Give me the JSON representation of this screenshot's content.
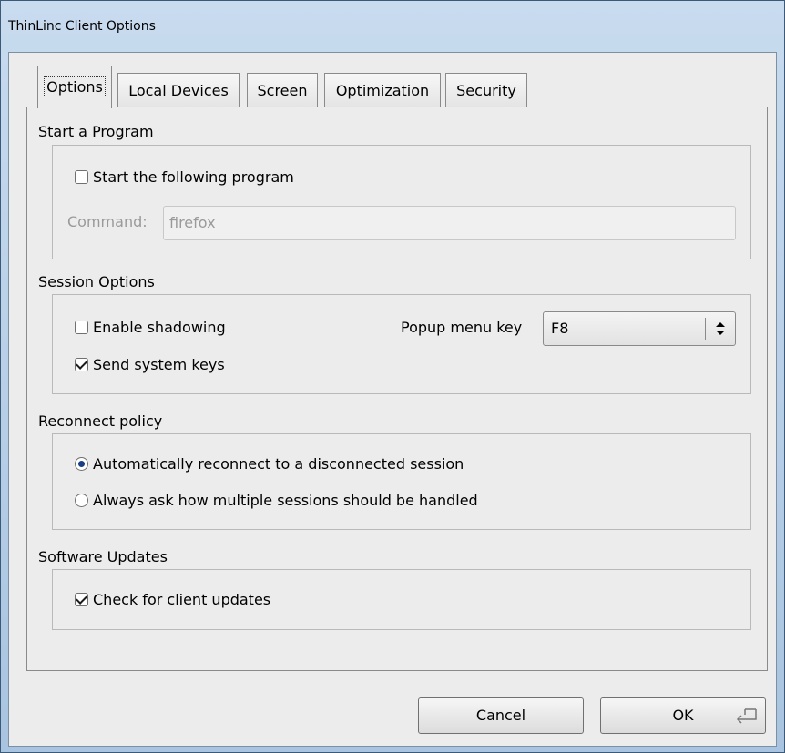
{
  "window": {
    "title": "ThinLinc Client Options"
  },
  "tabs": [
    {
      "label": "Options",
      "active": true
    },
    {
      "label": "Local Devices",
      "active": false
    },
    {
      "label": "Screen",
      "active": false
    },
    {
      "label": "Optimization",
      "active": false
    },
    {
      "label": "Security",
      "active": false
    }
  ],
  "start_program": {
    "title": "Start a Program",
    "checkbox_label": "Start the following program",
    "checked": false,
    "command_label": "Command:",
    "command_value": "firefox"
  },
  "session_options": {
    "title": "Session Options",
    "shadowing_label": "Enable shadowing",
    "shadowing_checked": false,
    "system_keys_label": "Send system keys",
    "system_keys_checked": true,
    "popup_label": "Popup menu key",
    "popup_value": "F8"
  },
  "reconnect_policy": {
    "title": "Reconnect policy",
    "option_auto": "Automatically reconnect to a disconnected session",
    "option_ask": "Always ask how multiple sessions should be handled",
    "selected": "auto"
  },
  "software_updates": {
    "title": "Software Updates",
    "check_label": "Check for client updates",
    "checked": true
  },
  "buttons": {
    "cancel": "Cancel",
    "ok": "OK"
  }
}
